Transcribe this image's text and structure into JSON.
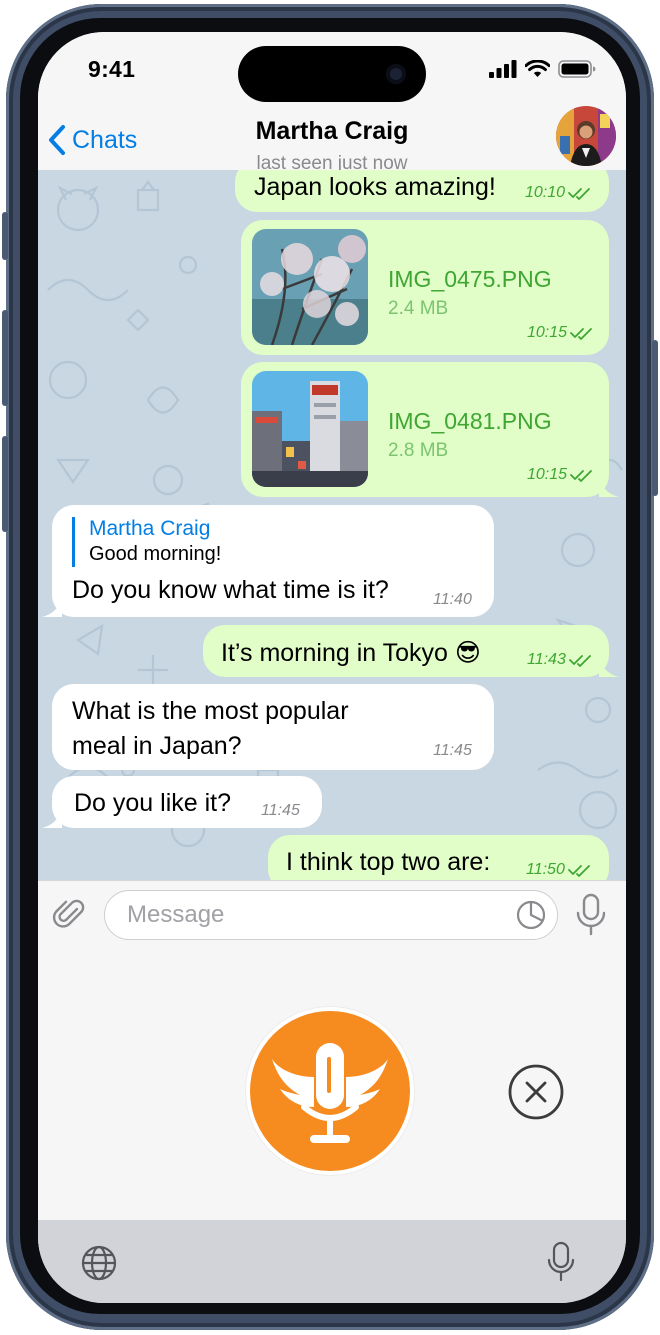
{
  "status_bar": {
    "time": "9:41"
  },
  "header": {
    "back_label": "Chats",
    "title": "Martha Craig",
    "subtitle": "last seen just now"
  },
  "messages": [
    {
      "direction": "out",
      "text": "Japan looks amazing!",
      "time": "10:10"
    },
    {
      "direction": "out",
      "kind": "file",
      "file_name": "IMG_0475.PNG",
      "file_size": "2.4 MB",
      "time": "10:15"
    },
    {
      "direction": "out",
      "kind": "file",
      "file_name": "IMG_0481.PNG",
      "file_size": "2.8 MB",
      "time": "10:15"
    },
    {
      "direction": "in",
      "reply_author": "Martha Craig",
      "reply_text": "Good morning!",
      "text": "Do you know what time is it?",
      "time": "11:40"
    },
    {
      "direction": "out",
      "text": "It’s morning in Tokyo 😎",
      "time": "11:43"
    },
    {
      "direction": "in",
      "text_line1": "What is the most popular",
      "text_line2": "meal in Japan?",
      "time": "11:45"
    },
    {
      "direction": "in",
      "text": "Do you like it?",
      "time": "11:45"
    },
    {
      "direction": "out",
      "text": "I think top two are:",
      "time": "11:50"
    }
  ],
  "composer": {
    "placeholder": "Message"
  },
  "colors": {
    "accent": "#037ee5",
    "outgoing_bubble": "#e1fdc8",
    "outgoing_text_meta": "#3fa633",
    "record_button": "#f68b1f",
    "chat_background": "#c9d7e3"
  },
  "icons": {
    "composer": [
      "paperclip-icon",
      "sticker-icon",
      "microphone-icon"
    ],
    "record": [
      "winged-microphone-icon",
      "close-circle-icon"
    ],
    "keyboard": [
      "globe-icon",
      "dictation-icon"
    ]
  }
}
